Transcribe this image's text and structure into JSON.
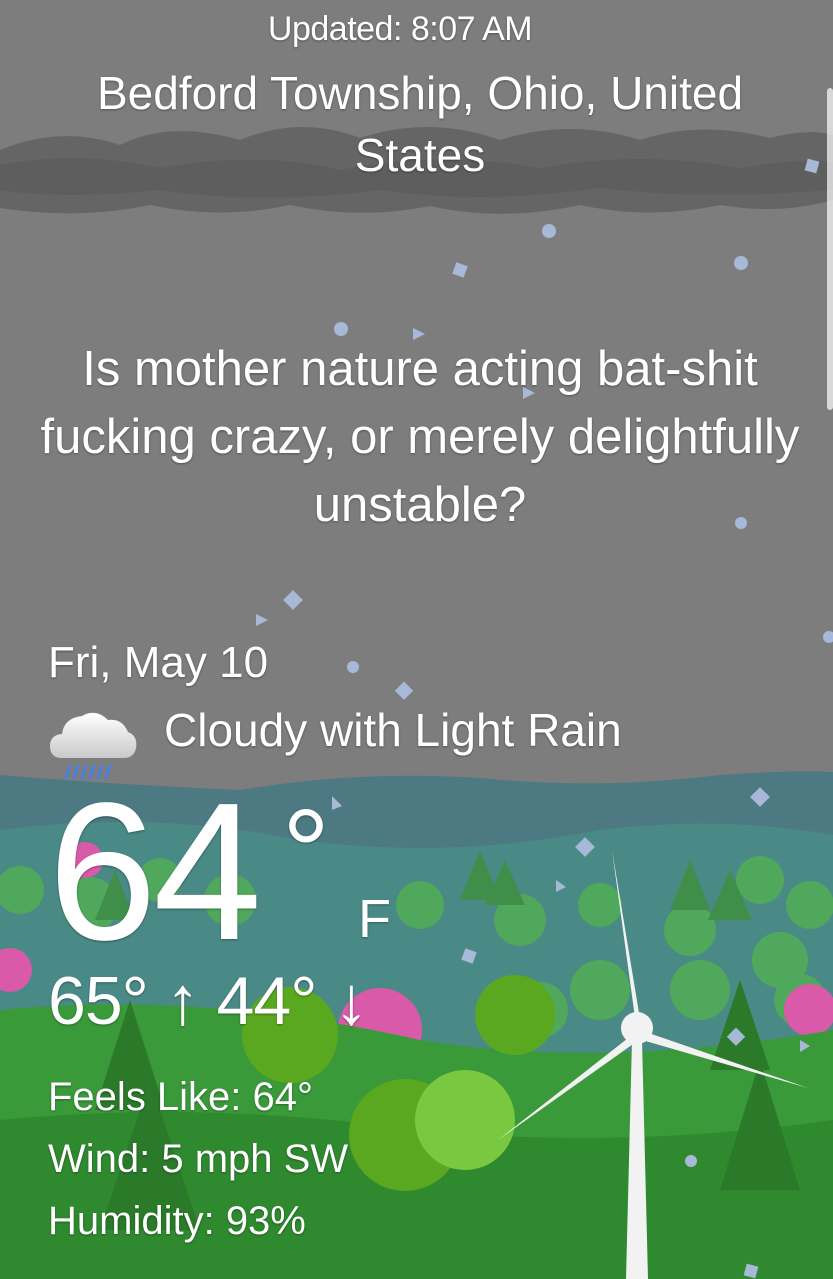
{
  "header": {
    "updated": "Updated: 8:07 AM",
    "location": "Bedford Township, Ohio, United States"
  },
  "quote": "Is mother nature acting bat-shit fucking crazy, or merely delightfully unstable?",
  "forecast": {
    "date": "Fri, May 10",
    "condition": "Cloudy with Light Rain",
    "condition_icon": "cloud-rain-icon",
    "temperature": "64",
    "degree_symbol": "°",
    "unit": "F",
    "hi_lo": "65° ↑ 44° ↓",
    "feels_like": "Feels Like: 64°",
    "wind": "Wind: 5 mph SW",
    "humidity": "Humidity: 93%"
  },
  "colors": {
    "sky": "#7d7d7d",
    "hills": "#4d7a82",
    "grass": "#3a9a3a",
    "rain_drop": "#a8b8d8"
  }
}
